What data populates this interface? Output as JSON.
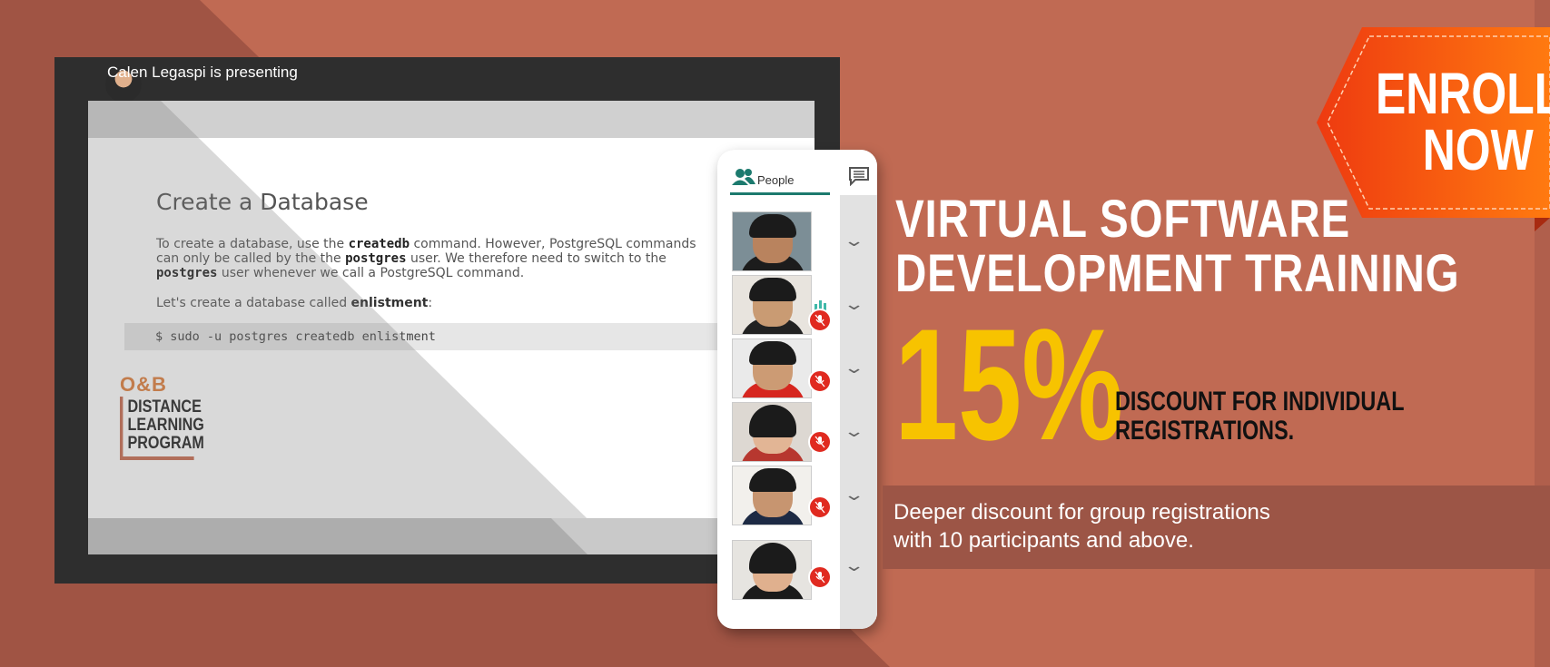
{
  "presenter": {
    "name_status": "Calen Legaspi is presenting"
  },
  "slide": {
    "title": "Create a Database",
    "para_1a": "To create a database, use the ",
    "cmd_createdb": "createdb",
    "para_1b": " command. However, PostgreSQL commands can only be called by the the ",
    "cmd_postgres_1": "postgres",
    "para_1c": " user. We therefore need to switch to the ",
    "cmd_postgres_2": "postgres",
    "para_1d": " user whenever we call a PostgreSQL command.",
    "para_2a": "Let's create a database called ",
    "db_name": "enlistment",
    "para_2b": ":",
    "code": "$ sudo -u postgres createdb enlistment"
  },
  "logo": {
    "ob": "O&B",
    "line1": "DISTANCE",
    "line2": "LEARNING",
    "line3": "PROGRAM"
  },
  "people_panel": {
    "tab_label": "People",
    "participant_count": 6
  },
  "promo": {
    "headline_1": "VIRTUAL SOFTWARE",
    "headline_2": "DEVELOPMENT TRAINING",
    "percent": "15%",
    "discount_1": "DISCOUNT FOR INDIVIDUAL",
    "discount_2": "REGISTRATIONS.",
    "group_1": "Deeper discount for group registrations",
    "group_2": "with 10 participants and above.",
    "cta_1": "ENROLL",
    "cta_2": "NOW"
  },
  "colors": {
    "background": "#c06a53",
    "accent_yellow": "#f7c300",
    "cta_orange": "#f55a10",
    "band": "#9c5546",
    "mute_red": "#e02a20",
    "tab_teal": "#1c7a6e"
  },
  "icons": [
    "people-icon",
    "chat-icon",
    "chevron-down-icon",
    "mic-off-icon",
    "speaking-icon"
  ]
}
